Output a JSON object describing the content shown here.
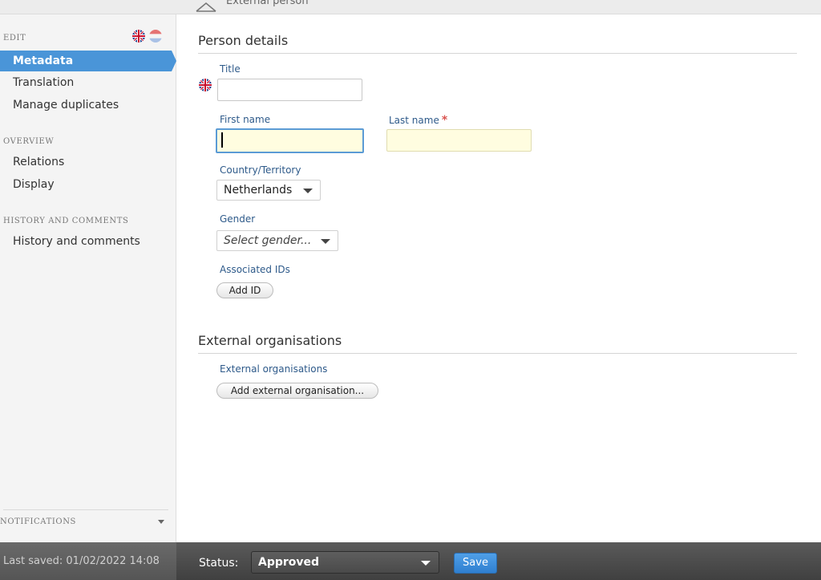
{
  "header": {
    "title": "External person",
    "icon": "person-icon"
  },
  "sidebar": {
    "sections": [
      {
        "label": "EDIT"
      },
      {
        "label": "OVERVIEW"
      },
      {
        "label": "HISTORY AND COMMENTS"
      }
    ],
    "items": [
      {
        "label": "Metadata",
        "active": true
      },
      {
        "label": "Translation"
      },
      {
        "label": "Manage duplicates"
      },
      {
        "label": "Relations"
      },
      {
        "label": "Display"
      },
      {
        "label": "History and comments"
      }
    ],
    "language_flags": [
      "uk-flag-icon",
      "netherlands-flag-icon"
    ],
    "notifications_label": "NOTIFICATIONS",
    "active_color": "#4a95d8"
  },
  "person_details": {
    "section_title": "Person details",
    "title_label": "Title",
    "title_value": "",
    "first_name_label": "First name",
    "first_name_value": "",
    "last_name_label": "Last name",
    "last_name_value": "",
    "required_mark": "*",
    "country_label": "Country/Territory",
    "country_value": "Netherlands",
    "gender_label": "Gender",
    "gender_placeholder": "Select gender...",
    "associated_ids_label": "Associated IDs",
    "add_id_label": "Add ID"
  },
  "external_orgs": {
    "section_title": "External organisations",
    "label": "External organisations",
    "add_label": "Add external organisation..."
  },
  "statusbar": {
    "last_saved": "Last saved: 01/02/2022 14:08",
    "status_label": "Status:",
    "status_value": "Approved",
    "save_label": "Save",
    "save_color": "#3a8ad9"
  }
}
